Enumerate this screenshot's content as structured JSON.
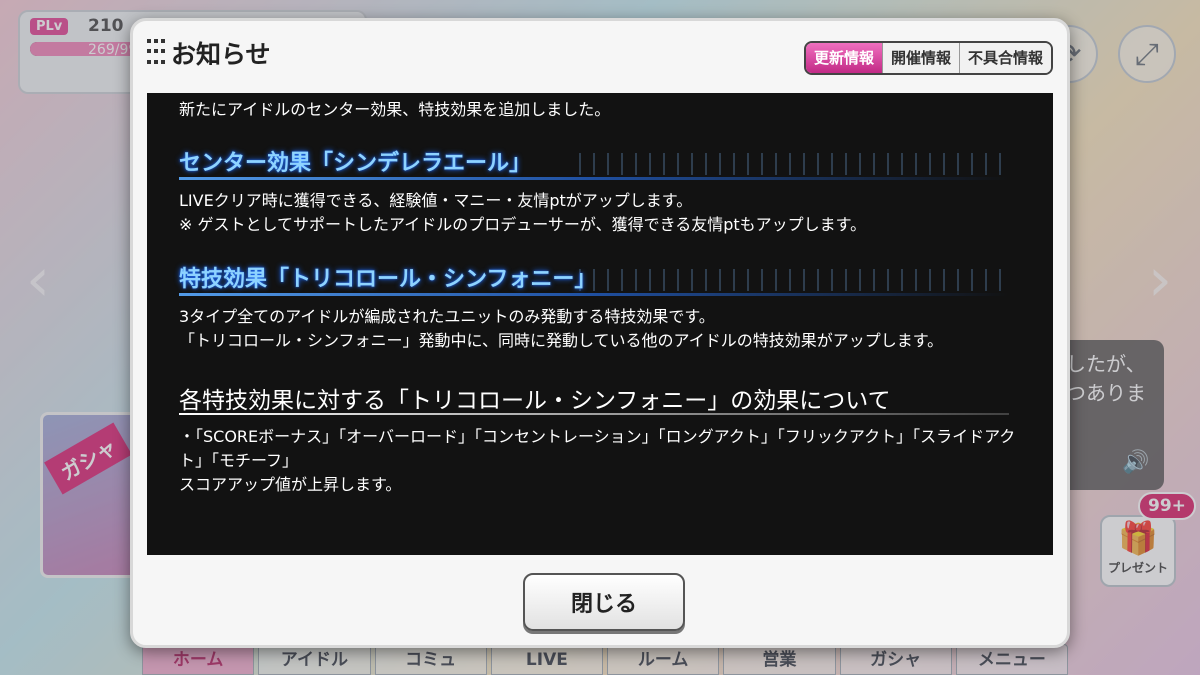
{
  "status": {
    "plv_tag": "PLv",
    "level": "210",
    "stamina": "269/99",
    "stamina_fill": 0.75
  },
  "background": {
    "gacha_label": "ガシャ",
    "chat_text": "したが、\nつありま",
    "present_label": "プレゼント",
    "present_badge": "99+"
  },
  "nav": [
    "ホーム",
    "アイドル",
    "コミュ",
    "LIVE",
    "ルーム",
    "営業",
    "ガシャ",
    "メニュー"
  ],
  "modal": {
    "title": "お知らせ",
    "tabs": [
      {
        "label": "更新情報",
        "active": true
      },
      {
        "label": "開催情報",
        "active": false
      },
      {
        "label": "不具合情報",
        "active": false
      }
    ],
    "intro": "新たにアイドルのセンター効果、特技効果を追加しました。",
    "sections": [
      {
        "heading": "センター効果「シンデレラエール」",
        "lines": [
          "LIVEクリア時に獲得できる、経験値・マニー・友情ptがアップします。",
          "※ ゲストとしてサポートしたアイドルのプロデューサーが、獲得できる友情ptもアップします。"
        ]
      },
      {
        "heading": "特技効果「トリコロール・シンフォニー」",
        "lines": [
          "3タイプ全てのアイドルが編成されたユニットのみ発動する特技効果です。",
          "「トリコロール・シンフォニー」発動中に、同時に発動している他のアイドルの特技効果がアップします。"
        ]
      }
    ],
    "subsection": {
      "heading": "各特技効果に対する「トリコロール・シンフォニー」の効果について",
      "lines": [
        "・「SCOREボーナス」「オーバーロード」「コンセントレーション」「ロングアクト」「フリックアクト」「スライドアクト」「モチーフ」",
        "スコアアップ値が上昇します。"
      ]
    },
    "close_label": "閉じる"
  }
}
